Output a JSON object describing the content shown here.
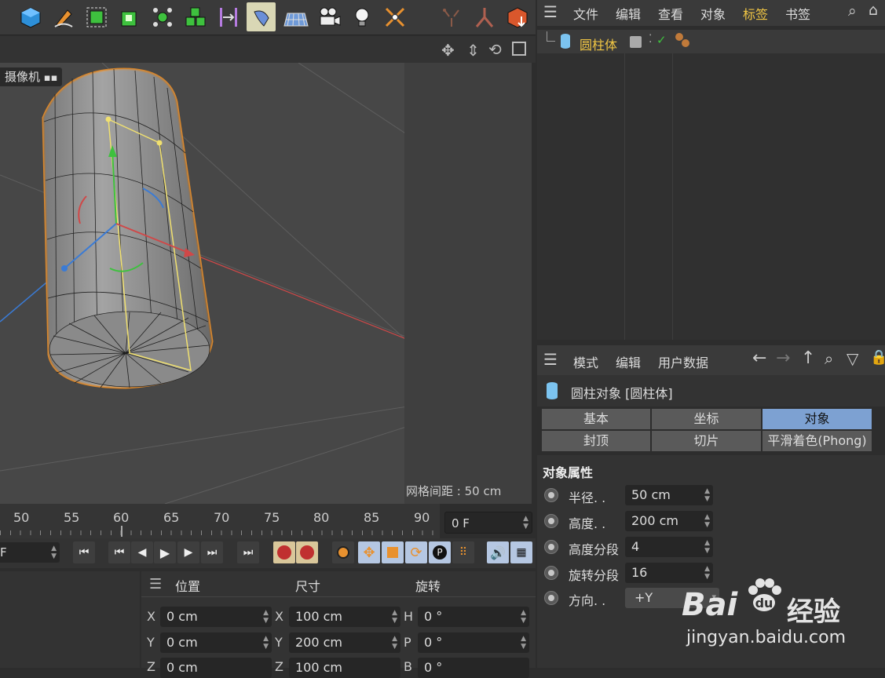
{
  "viewport": {
    "camera_label": "摄像机",
    "grid_label": "网格间距 : 50 cm"
  },
  "timeline": {
    "ticks": [
      "50",
      "55",
      "60",
      "65",
      "70",
      "75",
      "80",
      "85",
      "90"
    ],
    "current_frame": "0 F",
    "start_frame_fragment": "F"
  },
  "object_manager": {
    "menu": [
      "文件",
      "编辑",
      "查看",
      "对象",
      "标签",
      "书签"
    ],
    "active_menu": "标签",
    "object_name": "圆柱体"
  },
  "attributes": {
    "menu": [
      "模式",
      "编辑",
      "用户数据"
    ],
    "title": "圆柱对象 [圆柱体]",
    "tabs_row1": [
      "基本",
      "坐标",
      "对象"
    ],
    "tabs_row2": [
      "封顶",
      "切片",
      "平滑着色(Phong)"
    ],
    "selected_tab": "对象",
    "section": "对象属性",
    "props": [
      {
        "label": "半径. .",
        "value": "50 cm"
      },
      {
        "label": "高度. .",
        "value": "200 cm"
      },
      {
        "label": "高度分段",
        "value": "4"
      },
      {
        "label": "旋转分段",
        "value": "16"
      },
      {
        "label": "方向. .",
        "value": "+Y"
      }
    ]
  },
  "coordinates": {
    "headers": [
      "位置",
      "尺寸",
      "旋转"
    ],
    "rows": [
      {
        "pos_axis": "X",
        "pos": "0 cm",
        "size_axis": "X",
        "size": "100 cm",
        "rot_axis": "H",
        "rot": "0 °"
      },
      {
        "pos_axis": "Y",
        "pos": "0 cm",
        "size_axis": "Y",
        "size": "200 cm",
        "rot_axis": "P",
        "rot": "0 °"
      },
      {
        "pos_axis": "Z",
        "pos": "0 cm",
        "size_axis": "Z",
        "size": "100 cm",
        "rot_axis": "B",
        "rot": "0 °"
      }
    ]
  },
  "watermark": {
    "brand": "Bai",
    "brand_suffix": "经验",
    "url": "jingyan.baidu.com"
  },
  "colors": {
    "accent_tab": "#7da1d2",
    "active_menu": "#f2c744",
    "selection_outline": "#d9872c"
  }
}
